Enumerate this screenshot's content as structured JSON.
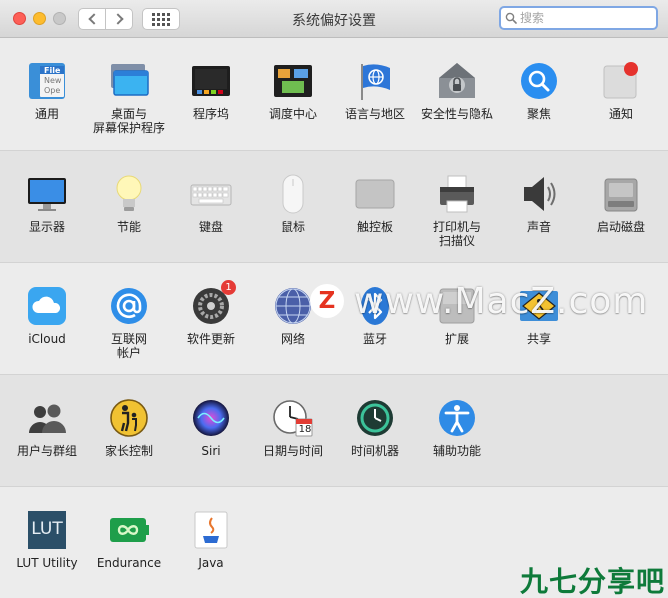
{
  "window": {
    "title": "系统偏好设置"
  },
  "search": {
    "placeholder": "搜索",
    "value": ""
  },
  "sections": [
    [
      {
        "label": "通用",
        "icon": "general-icon",
        "file_badge": [
          "File",
          "New",
          "Ope"
        ]
      },
      {
        "label": "桌面与\n屏幕保护程序",
        "icon": "desktop-screensaver-icon"
      },
      {
        "label": "程序坞",
        "icon": "dock-icon"
      },
      {
        "label": "调度中心",
        "icon": "mission-control-icon"
      },
      {
        "label": "语言与地区",
        "icon": "language-region-icon"
      },
      {
        "label": "安全性与隐私",
        "icon": "security-privacy-icon"
      },
      {
        "label": "聚焦",
        "icon": "spotlight-icon"
      },
      {
        "label": "通知",
        "icon": "notifications-icon"
      }
    ],
    [
      {
        "label": "显示器",
        "icon": "displays-icon"
      },
      {
        "label": "节能",
        "icon": "energy-saver-icon"
      },
      {
        "label": "键盘",
        "icon": "keyboard-icon"
      },
      {
        "label": "鼠标",
        "icon": "mouse-icon"
      },
      {
        "label": "触控板",
        "icon": "trackpad-icon"
      },
      {
        "label": "打印机与\n扫描仪",
        "icon": "printers-scanners-icon"
      },
      {
        "label": "声音",
        "icon": "sound-icon"
      },
      {
        "label": "启动磁盘",
        "icon": "startup-disk-icon"
      }
    ],
    [
      {
        "label": "iCloud",
        "icon": "icloud-icon"
      },
      {
        "label": "互联网\n帐户",
        "icon": "internet-accounts-icon"
      },
      {
        "label": "软件更新",
        "icon": "software-update-icon",
        "badge": "1"
      },
      {
        "label": "网络",
        "icon": "network-icon"
      },
      {
        "label": "蓝牙",
        "icon": "bluetooth-icon"
      },
      {
        "label": "扩展",
        "icon": "extensions-icon"
      },
      {
        "label": "共享",
        "icon": "sharing-icon"
      }
    ],
    [
      {
        "label": "用户与群组",
        "icon": "users-groups-icon"
      },
      {
        "label": "家长控制",
        "icon": "parental-controls-icon"
      },
      {
        "label": "Siri",
        "icon": "siri-icon"
      },
      {
        "label": "日期与时间",
        "icon": "date-time-icon",
        "calendar_label": "JUL",
        "calendar_day": "18"
      },
      {
        "label": "时间机器",
        "icon": "time-machine-icon"
      },
      {
        "label": "辅助功能",
        "icon": "accessibility-icon"
      }
    ],
    [
      {
        "label": "LUT Utility",
        "icon": "lut-utility-icon",
        "icon_text": "LUT"
      },
      {
        "label": "Endurance",
        "icon": "endurance-icon"
      },
      {
        "label": "Java",
        "icon": "java-icon"
      }
    ]
  ],
  "watermark": {
    "logo": "Z",
    "text": "www.MacZ.com"
  },
  "corner_watermark": "九七分享吧",
  "colors": {
    "highlight": "#e01b1b",
    "accent": "#2a8ef0",
    "badge": "#e53b36"
  }
}
